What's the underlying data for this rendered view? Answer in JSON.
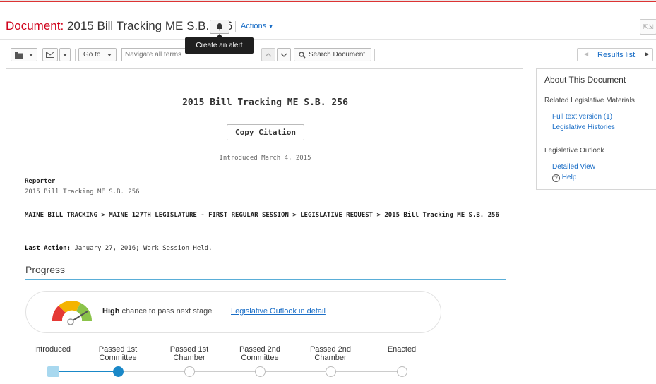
{
  "header": {
    "doc_label": "Document:",
    "doc_name": "2015 Bill Tracking ME S.B. 256",
    "actions_label": "Actions"
  },
  "tooltip": {
    "text": "Create an alert"
  },
  "toolbar": {
    "goto_label": "Go to",
    "navigate_placeholder": "Navigate all terms",
    "search_label": "Search Document",
    "results_label": "Results list"
  },
  "main": {
    "bill_title": "2015 Bill Tracking ME S.B. 256",
    "copy_citation": "Copy Citation",
    "introduced": "Introduced March 4, 2015",
    "reporter_heading": "Reporter",
    "reporter_value": "2015 Bill Tracking ME S.B. 256",
    "path": "MAINE BILL TRACKING > MAINE 127TH LEGISLATURE - FIRST REGULAR SESSION > LEGISLATIVE REQUEST > 2015 Bill Tracking ME S.B. 256",
    "last_action_label": "Last Action:",
    "last_action_value": "January 27, 2016; Work Session Held.",
    "progress_heading": "Progress",
    "outlook": {
      "chance_level": "High",
      "chance_text": "chance to pass next stage",
      "detail_link": "Legislative Outlook in detail"
    },
    "stages": [
      {
        "line1": "Introduced",
        "line2": "",
        "status": "completed"
      },
      {
        "line1": "Passed 1st",
        "line2": "Committee",
        "status": "current"
      },
      {
        "line1": "Passed 1st",
        "line2": "Chamber",
        "status": "pending"
      },
      {
        "line1": "Passed 2nd",
        "line2": "Committee",
        "status": "pending"
      },
      {
        "line1": "Passed 2nd",
        "line2": "Chamber",
        "status": "pending"
      },
      {
        "line1": "Enacted",
        "line2": "",
        "status": "pending"
      }
    ]
  },
  "sidebar": {
    "title": "About This Document",
    "related_heading": "Related Legislative Materials",
    "full_text_link": "Full text version (1)",
    "histories_link": "Legislative Histories",
    "outlook_heading": "Legislative Outlook",
    "detailed_view_link": "Detailed View",
    "help_link": "Help"
  },
  "colors": {
    "accent_blue": "#1a6ec7",
    "doc_label_red": "#d0021b",
    "progress_blue": "#1a88c8",
    "completed_stage": "#a8d8ef"
  }
}
